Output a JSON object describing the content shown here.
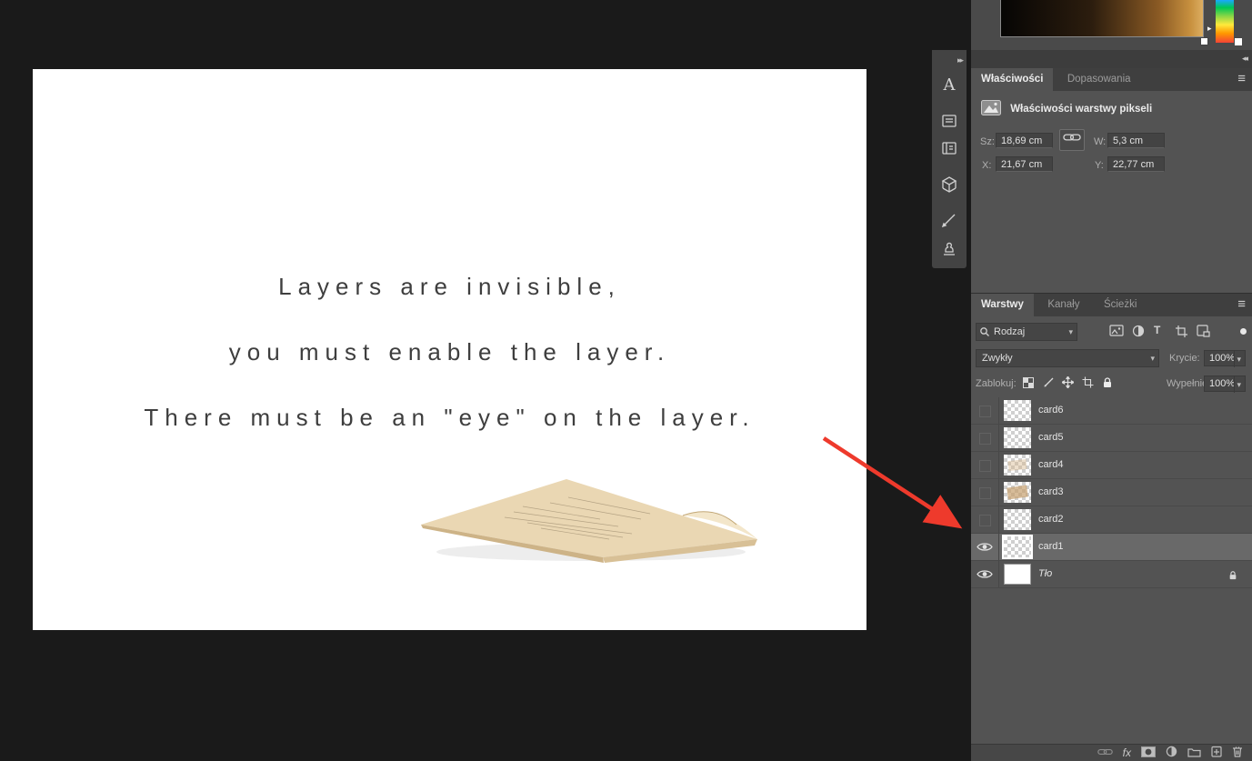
{
  "colors": {
    "arrow_red": "#ee3a2c",
    "selected_layer_bg": "#696969",
    "panel_bg": "#535353",
    "canvas_bg": "#ffffff"
  },
  "canvas": {
    "lines": [
      "Layers are invisible,",
      "you must enable the layer.",
      "There must be an \"eye\" on the layer."
    ]
  },
  "icons": {
    "menu": "≡",
    "chevron_down": "▾",
    "collapse": "◂◂",
    "expand": "▸▸",
    "letter_a": "A",
    "text_tool": "T",
    "fx": "fx",
    "rainbow_marker": "▸"
  },
  "properties_panel": {
    "tabs": {
      "properties": "Właściwości",
      "adjustments": "Dopasowania"
    },
    "subtitle": "Właściwości warstwy pikseli",
    "sz_label": "Sz:",
    "sz_value": "18,69 cm",
    "w_label": "W:",
    "w_value": "5,3 cm",
    "x_label": "X:",
    "x_value": "21,67 cm",
    "y_label": "Y:",
    "y_value": "22,77 cm"
  },
  "layers_panel": {
    "tabs": {
      "layers": "Warstwy",
      "channels": "Kanały",
      "paths": "Ścieżki"
    },
    "filter_label": "Rodzaj",
    "blend_mode": "Zwykły",
    "opacity_label": "Krycie:",
    "opacity_value": "100%",
    "lock_label": "Zablokuj:",
    "fill_label": "Wypełnienie:",
    "fill_value": "100%",
    "layers": [
      {
        "name": "card6",
        "visible": false,
        "selected": false
      },
      {
        "name": "card5",
        "visible": false,
        "selected": false
      },
      {
        "name": "card4",
        "visible": false,
        "selected": false
      },
      {
        "name": "card3",
        "visible": false,
        "selected": false
      },
      {
        "name": "card2",
        "visible": false,
        "selected": false
      },
      {
        "name": "card1",
        "visible": true,
        "selected": true
      },
      {
        "name": "Tło",
        "visible": true,
        "selected": false,
        "locked": true
      }
    ]
  }
}
